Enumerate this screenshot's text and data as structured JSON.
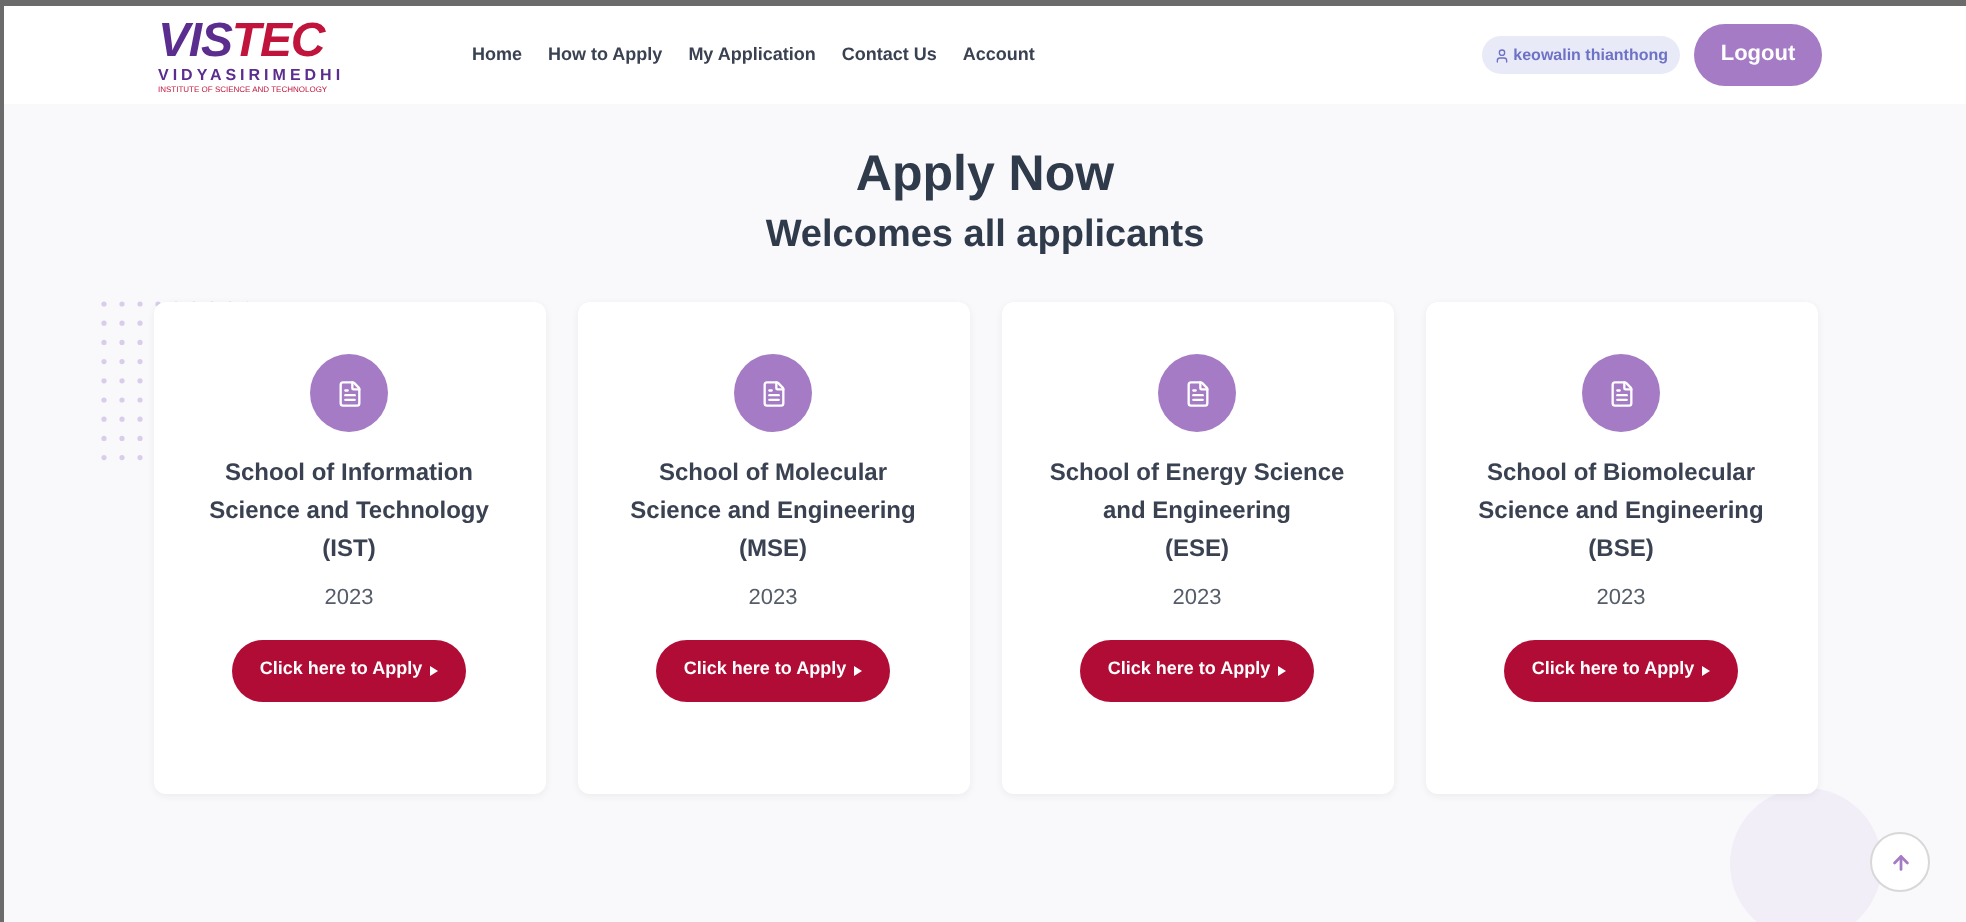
{
  "logo": {
    "wordmark_left": "VIS",
    "wordmark_right": "TEC",
    "name": "VIDYASIRIMEDHI",
    "tagline": "INSTITUTE OF SCIENCE AND TECHNOLOGY"
  },
  "nav": [
    "Home",
    "How to Apply",
    "My Application",
    "Contact Us",
    "Account"
  ],
  "user": {
    "name": "keowalin thianthong"
  },
  "logout": "Logout",
  "heading": "Apply Now",
  "subheading": "Welcomes all applicants",
  "schools": [
    {
      "name": "School of Information Science and Technology",
      "code": "(IST)",
      "year": "2023",
      "button": "Click here to Apply"
    },
    {
      "name": "School of Molecular Science and Engineering",
      "code": "(MSE)",
      "year": "2023",
      "button": "Click here to Apply"
    },
    {
      "name": "School of Energy Science and Engineering",
      "code": "(ESE)",
      "year": "2023",
      "button": "Click here to Apply"
    },
    {
      "name": "School of Biomolecular Science and Engineering",
      "code": "(BSE)",
      "year": "2023",
      "button": "Click here to Apply"
    }
  ]
}
